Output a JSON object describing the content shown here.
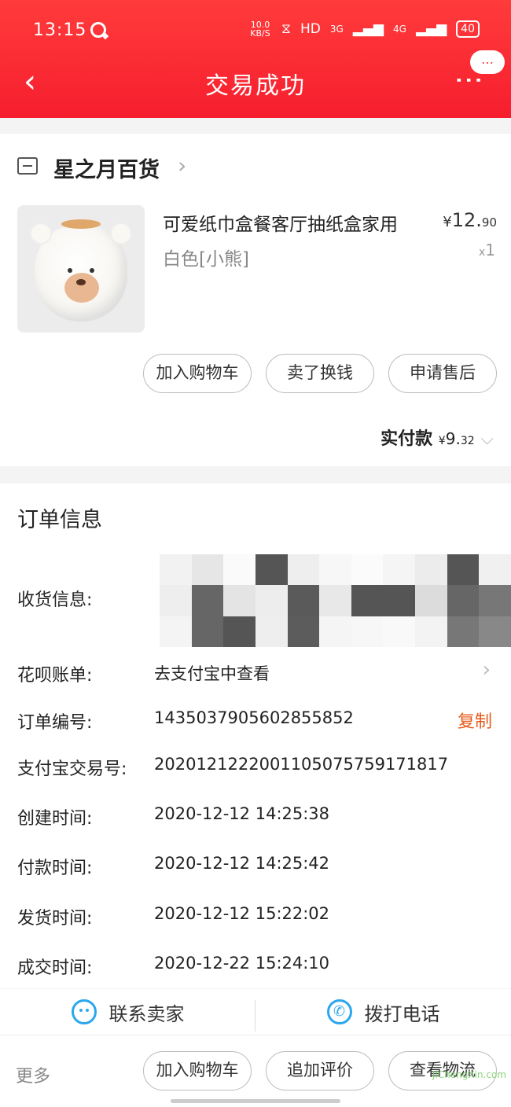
{
  "status_bar": {
    "time": "13:15",
    "net_speed": "10.0 KB/S",
    "network": "HD",
    "signal1": "3G",
    "signal2": "4G",
    "battery": "40"
  },
  "nav": {
    "title": "交易成功"
  },
  "store": {
    "name": "星之月百货"
  },
  "product": {
    "title": "可爱纸巾盒餐客厅抽纸盒家用",
    "spec": "白色[小熊]",
    "price_currency": "¥",
    "price_int": "12.",
    "price_dec": "90",
    "qty_prefix": "x",
    "qty": "1"
  },
  "actions": {
    "add_cart": "加入购物车",
    "sell": "卖了换钱",
    "after_sale": "申请售后"
  },
  "payment": {
    "label": "实付款",
    "currency": "¥",
    "int": "9.",
    "dec": "32"
  },
  "order_info": {
    "title": "订单信息",
    "shipping_label": "收货信息:",
    "huabei_label": "花呗账单:",
    "huabei_value": "去支付宝中查看",
    "order_no_label": "订单编号:",
    "order_no": "1435037905602855852",
    "copy": "复制",
    "alipay_label": "支付宝交易号:",
    "alipay_no": "2020121222001105075759171817",
    "created_label": "创建时间:",
    "created": "2020-12-12 14:25:38",
    "paid_label": "付款时间:",
    "paid": "2020-12-12 14:25:42",
    "shipped_label": "发货时间:",
    "shipped": "2020-12-12 15:22:02",
    "closed_label": "成交时间:",
    "closed": "2020-12-22 15:24:10"
  },
  "contact": {
    "seller": "联系卖家",
    "call": "拨打电话"
  },
  "bottom": {
    "more": "更多",
    "add_cart": "加入购物车",
    "review": "追加评价",
    "logistics": "查看物流"
  },
  "watermark": "JiChengXin.com",
  "colors": {
    "header": "#f61e2e",
    "accent_orange": "#e55b1a",
    "icon_blue": "#2aa7ef"
  }
}
